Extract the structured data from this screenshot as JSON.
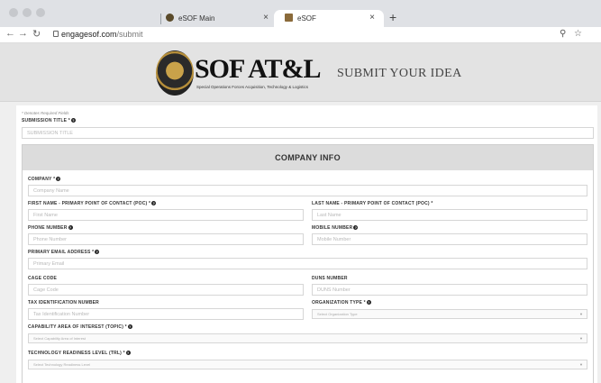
{
  "browser": {
    "tabs": [
      {
        "title": "eSOF Main",
        "favicon_color": "#5a4a2a",
        "active": false
      },
      {
        "title": "eSOF",
        "favicon_color": "#8a6a3a",
        "active": true
      }
    ],
    "close_glyph": "×",
    "new_tab_glyph": "+",
    "url_domain": "engagesof.com",
    "url_path": "/submit"
  },
  "header": {
    "logo_main": "SOF AT&L",
    "logo_sub": "Special Operations Forces  Acquisition, Technology & Logistics",
    "page_title": "SUBMIT YOUR IDEA"
  },
  "form": {
    "required_note": "* Denotes Required Fields",
    "submission_title": {
      "label": "SUBMISSION TITLE *",
      "placeholder": "SUBMISSION TITLE"
    },
    "section_title": "COMPANY INFO",
    "company": {
      "label": "COMPANY *",
      "placeholder": "Company Name"
    },
    "first_name": {
      "label": "FIRST NAME - PRIMARY POINT OF CONTACT (POC) *",
      "placeholder": "First Name"
    },
    "last_name": {
      "label": "LAST NAME - PRIMARY POINT OF CONTACT (POC) *",
      "placeholder": "Last Name"
    },
    "phone": {
      "label": "PHONE NUMBER",
      "placeholder": "Phone Number"
    },
    "mobile": {
      "label": "MOBILE NUMBER",
      "placeholder": "Mobile Number"
    },
    "email": {
      "label": "PRIMARY EMAIL ADDRESS *",
      "placeholder": "Primary Email"
    },
    "cage": {
      "label": "CAGE CODE",
      "placeholder": "Cage Code"
    },
    "duns": {
      "label": "DUNS NUMBER",
      "placeholder": "DUNS Number"
    },
    "tin": {
      "label": "TAX IDENTIFICATION NUMBER",
      "placeholder": "Tax Identification Number"
    },
    "org_type": {
      "label": "ORGANIZATION TYPE *",
      "placeholder": "Select Organization Type"
    },
    "capability": {
      "label": "CAPABILITY AREA OF INTEREST (TOPIC) *",
      "placeholder": "Select Capability Area of Interest"
    },
    "trl": {
      "label": "TECHNOLOGY READINESS LEVEL (TRL) *",
      "placeholder": "Select Technology Readiness Level"
    },
    "help_glyph": "?",
    "caret_glyph": "▼"
  }
}
